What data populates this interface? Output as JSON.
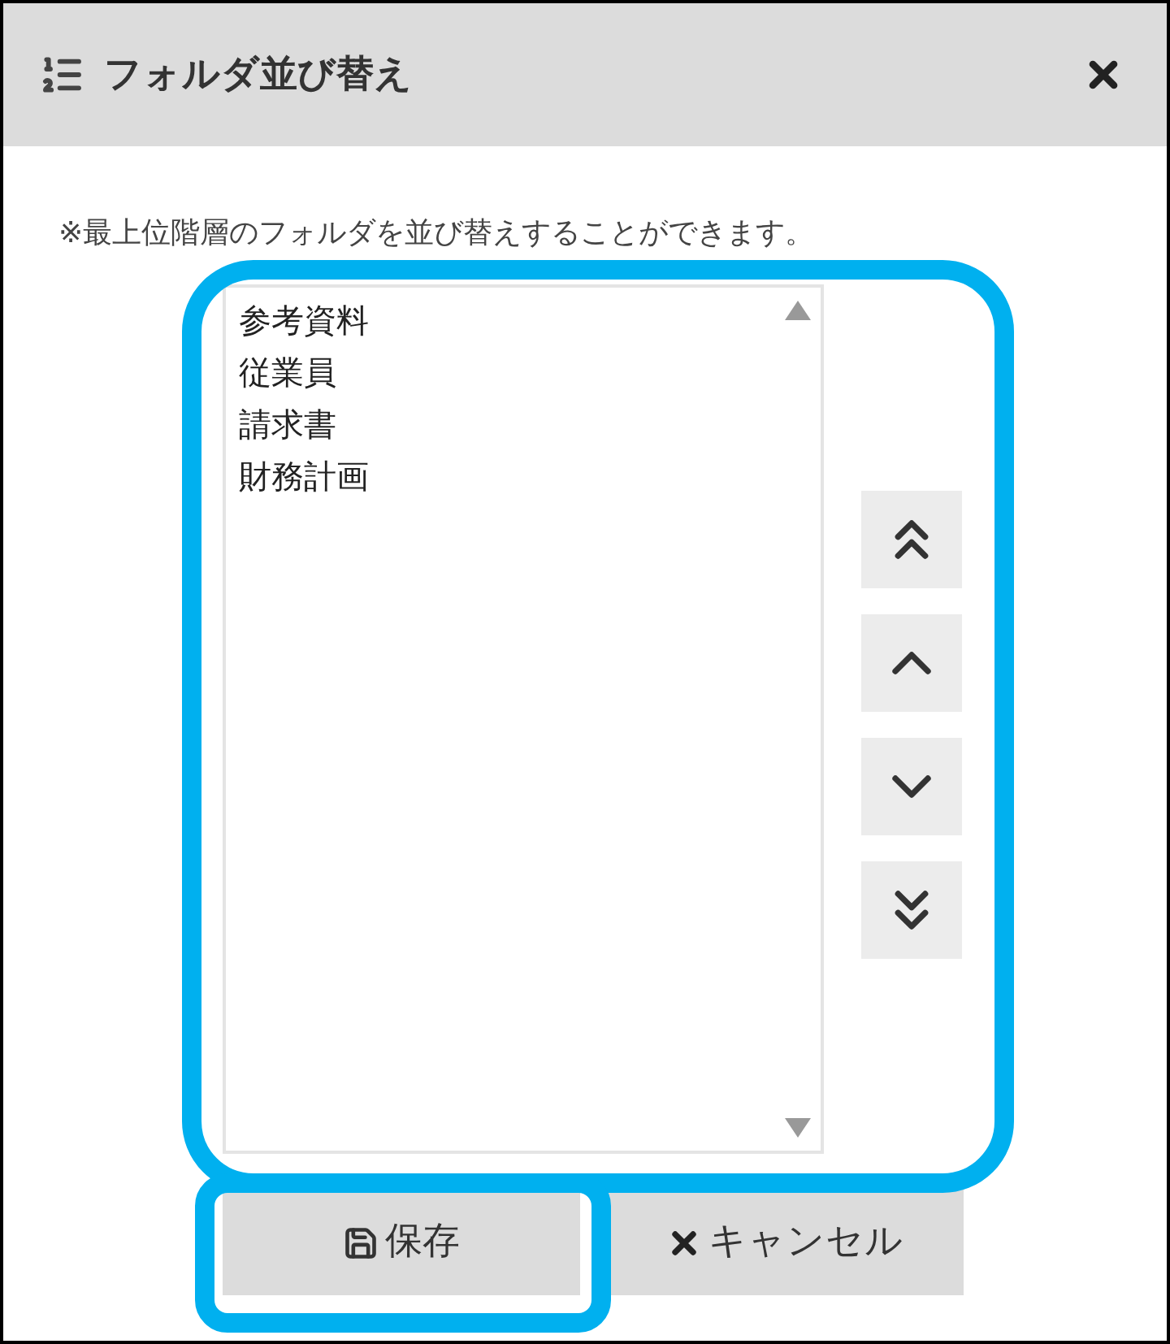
{
  "dialog": {
    "title": "フォルダ並び替え"
  },
  "note": "※最上位階層のフォルダを並び替えすることができます。",
  "folders": [
    "参考資料",
    "従業員",
    "請求書",
    "財務計画"
  ],
  "buttons": [
    {
      "kind": "save",
      "label": "保存"
    },
    {
      "kind": "cancel",
      "label": "キャンセル"
    }
  ]
}
